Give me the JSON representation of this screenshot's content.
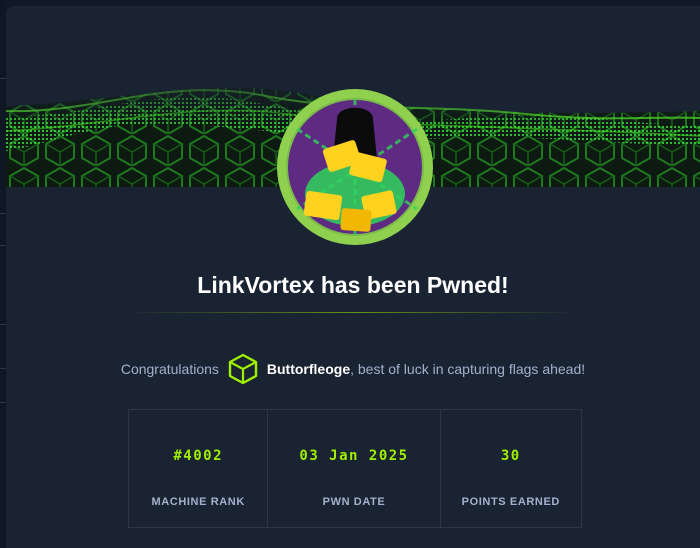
{
  "colors": {
    "accent": "#9fef00",
    "panel": "#1a2332",
    "text_muted": "#a4b1cd"
  },
  "modal": {
    "title": "LinkVortex has been Pwned!",
    "congrats_prefix": "Congratulations",
    "username": "Buttorfleoge",
    "congrats_suffix": ", best of luck in capturing flags ahead!",
    "icons": {
      "banner": "green-hex-wave-banner",
      "avatar": "machine-avatar-icon",
      "user": "htb-cube-icon"
    }
  },
  "stats": [
    {
      "value": "#4002",
      "label": "MACHINE RANK"
    },
    {
      "value": "03 Jan 2025",
      "label": "PWN DATE"
    },
    {
      "value": "30",
      "label": "POINTS EARNED"
    }
  ]
}
